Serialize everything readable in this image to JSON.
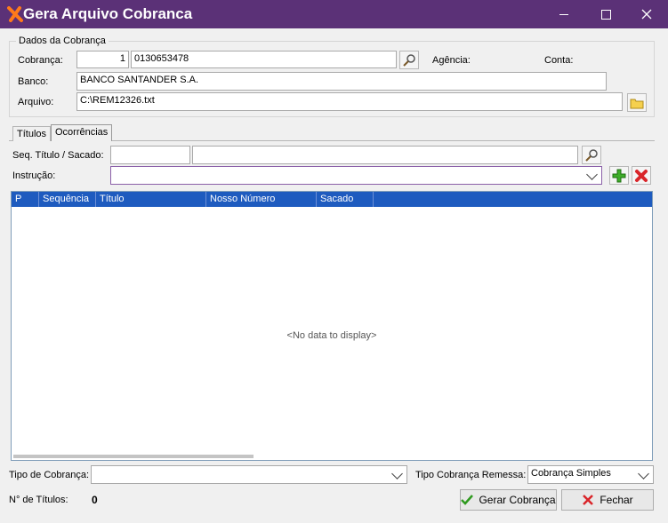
{
  "window": {
    "title": "Gera Arquivo Cobranca",
    "accent": "#5b3177"
  },
  "dados": {
    "legend": "Dados da Cobrança",
    "cobranca_label": "Cobrança:",
    "cobranca_code": "1",
    "cobranca_account": "0130653478",
    "agencia_label": "Agência:",
    "conta_label": "Conta:",
    "banco_label": "Banco:",
    "banco_value": "BANCO SANTANDER S.A.",
    "arquivo_label": "Arquivo:",
    "arquivo_value": "C:\\REM12326.txt"
  },
  "tabs": [
    {
      "label": "Títulos"
    },
    {
      "label": "Ocorrências"
    }
  ],
  "ocorrencias": {
    "seq_label": "Seq. Título / Sacado:",
    "seq_value": "",
    "sacado_value": "",
    "instrucao_label": "Instrução:",
    "instrucao_value": ""
  },
  "grid": {
    "columns": [
      "P",
      "Sequência",
      "Título",
      "Nosso Número",
      "Sacado"
    ],
    "empty_text": "<No data to display>",
    "header_color": "#1e5bbf"
  },
  "footer": {
    "tipo_label": "Tipo de Cobrança:",
    "tipo_value": "",
    "remessa_label": "Tipo Cobrança Remessa:",
    "remessa_value": "Cobrança Simples",
    "count_label": "N° de Títulos:",
    "count_value": "0",
    "gerar_label": "Gerar Cobrança",
    "fechar_label": "Fechar"
  }
}
